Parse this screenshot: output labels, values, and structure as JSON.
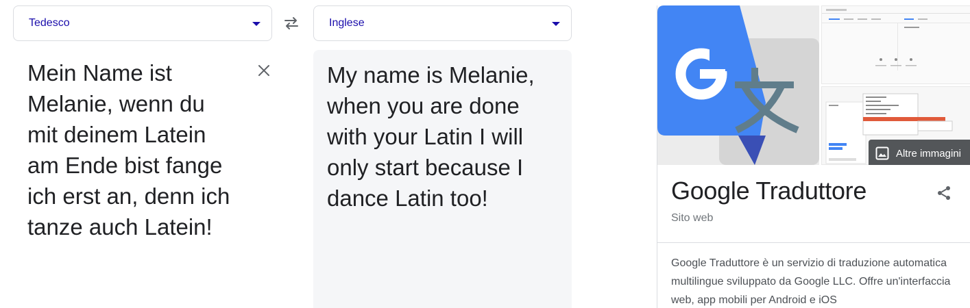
{
  "translator": {
    "source_language": "Tedesco",
    "target_language": "Inglese",
    "source_text": "Mein Name ist Melanie, wenn du mit deinem Latein am Ende bist fange ich erst an, denn ich tanze auch Latein!",
    "translated_text": "My name is Melanie, when you are done with your Latin I will only start because I dance Latin too!"
  },
  "icons": {
    "swap": "swap-arrows-icon",
    "clear": "close-icon",
    "dropdown": "caret-down-icon",
    "image": "image-icon",
    "share": "share-icon"
  },
  "knowledge_panel": {
    "more_images_label": "Altre immagini",
    "title": "Google Traduttore",
    "subtitle": "Sito web",
    "description": "Google Traduttore è un servizio di traduzione automatica multilingue sviluppato da Google LLC. Offre un'interfaccia web, app mobili per Android e iOS"
  },
  "colors": {
    "link_blue": "#1a0dab",
    "google_blue": "#4285f4",
    "translate_gray": "#dcdcdc",
    "target_panel_bg": "#f5f6f8"
  }
}
